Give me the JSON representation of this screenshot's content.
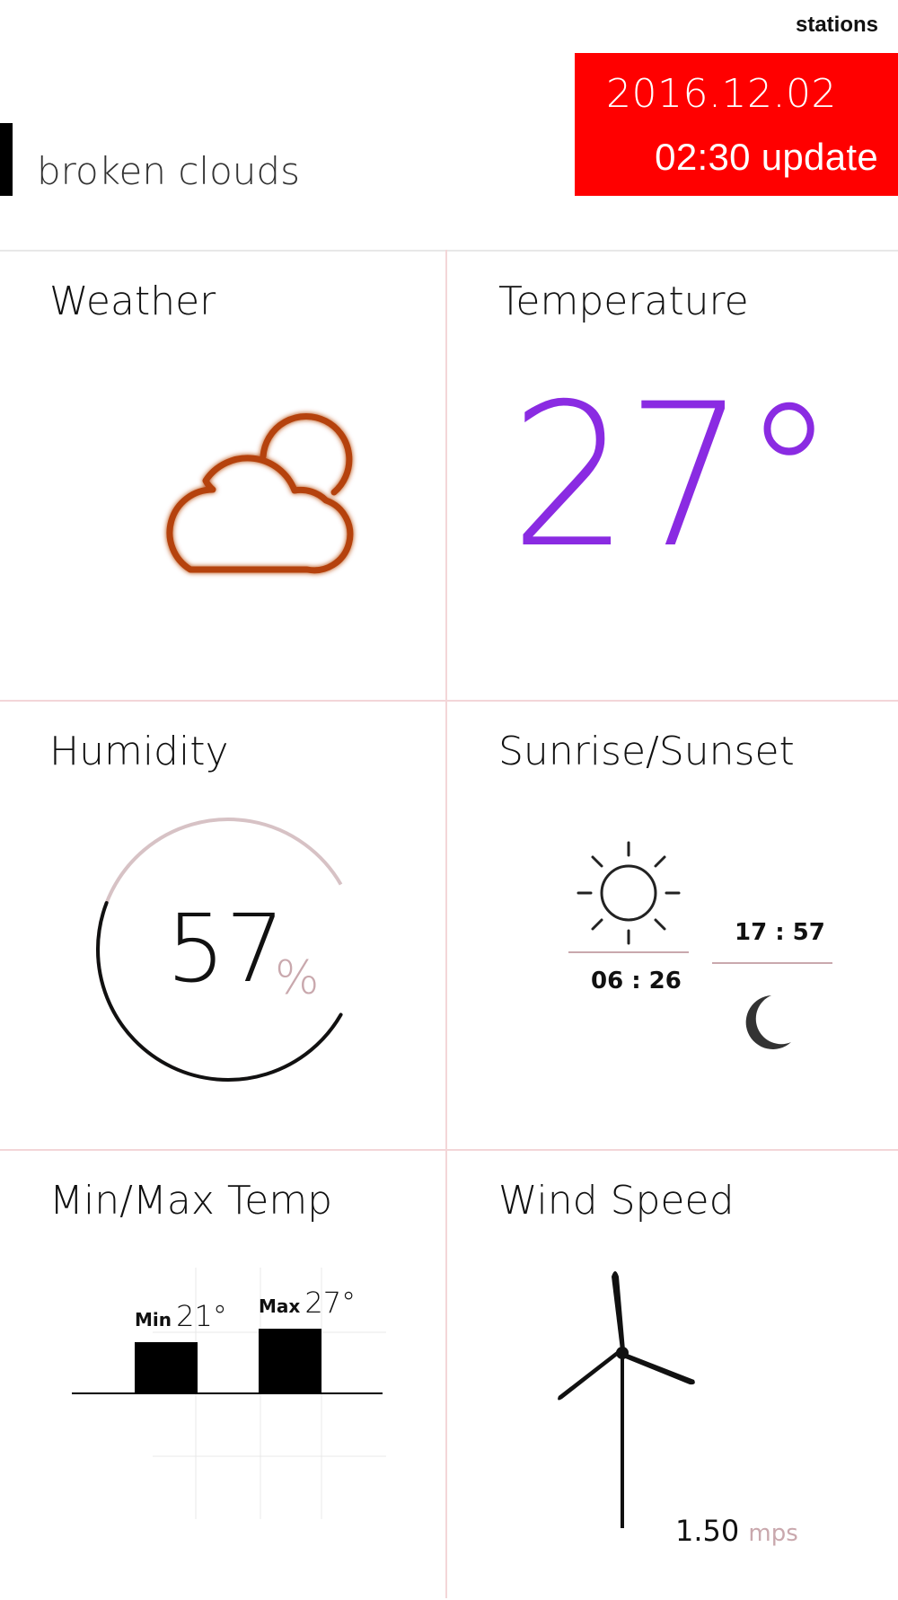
{
  "header": {
    "stations_label": "stations",
    "date": "2016.12.02",
    "update": "02:30 update",
    "condition": "broken clouds",
    "accent_color": "#ff0000"
  },
  "panels": {
    "weather": {
      "title": "Weather",
      "icon": "cloud-sun-icon",
      "icon_color": "#b5420a"
    },
    "temperature": {
      "title": "Temperature",
      "value": "27°",
      "color": "#8a2be2"
    },
    "humidity": {
      "title": "Humidity",
      "value": "57",
      "unit": "%",
      "gauge_fraction": 0.57
    },
    "sunrise_sunset": {
      "title": "Sunrise/Sunset",
      "sunrise": "06 : 26",
      "sunset": "17 : 57",
      "sunrise_icon": "sun-icon",
      "sunset_icon": "moon-icon"
    },
    "minmax": {
      "title": "Min/Max Temp",
      "min_label": "Min",
      "min_value": "21°",
      "max_label": "Max",
      "max_value": "27°"
    },
    "wind": {
      "title": "Wind Speed",
      "value": "1.50",
      "unit": "mps",
      "icon": "wind-turbine-icon"
    }
  },
  "chart_data": {
    "type": "bar",
    "categories": [
      "Min",
      "Max"
    ],
    "values": [
      21,
      27
    ],
    "title": "Min/Max Temp",
    "xlabel": "",
    "ylabel": ""
  }
}
